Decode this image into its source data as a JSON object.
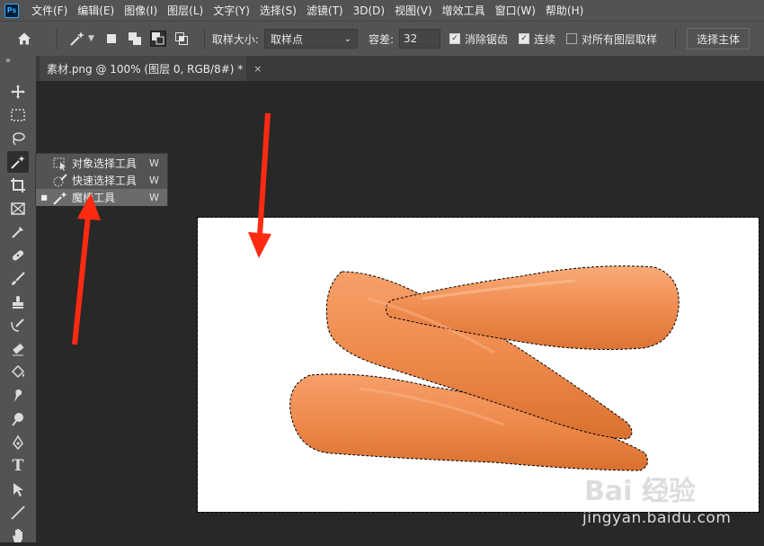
{
  "app": {
    "logo_text": "Ps"
  },
  "menu": [
    "文件(F)",
    "编辑(E)",
    "图像(I)",
    "图层(L)",
    "文字(Y)",
    "选择(S)",
    "滤镜(T)",
    "3D(D)",
    "视图(V)",
    "增效工具",
    "窗口(W)",
    "帮助(H)"
  ],
  "options": {
    "sample_size_label": "取样大小:",
    "sample_size_value": "取样点",
    "tolerance_label": "容差:",
    "tolerance_value": "32",
    "antialias_label": "消除锯齿",
    "antialias_checked": true,
    "contiguous_label": "连续",
    "contiguous_checked": true,
    "all_layers_label": "对所有图层取样",
    "all_layers_checked": false,
    "select_subject_label": "选择主体"
  },
  "document_tab": {
    "title": "素材.png @ 100% (图层 0, RGB/8#) *",
    "close": "×"
  },
  "toolbar": {
    "collapse_glyph": "»",
    "type_tool_glyph": "T"
  },
  "flyout": {
    "items": [
      {
        "label": "对象选择工具",
        "key": "W",
        "selected": false
      },
      {
        "label": "快速选择工具",
        "key": "W",
        "selected": false
      },
      {
        "label": "魔棒工具",
        "key": "W",
        "selected": true
      }
    ]
  },
  "watermark": {
    "logo_text": "Bai  经验",
    "url": "jingyan.baidu.com"
  },
  "colors": {
    "arrow": "#ff2a12",
    "carrot": "#f08a4a",
    "panel": "#535353",
    "workspace": "#282828"
  }
}
